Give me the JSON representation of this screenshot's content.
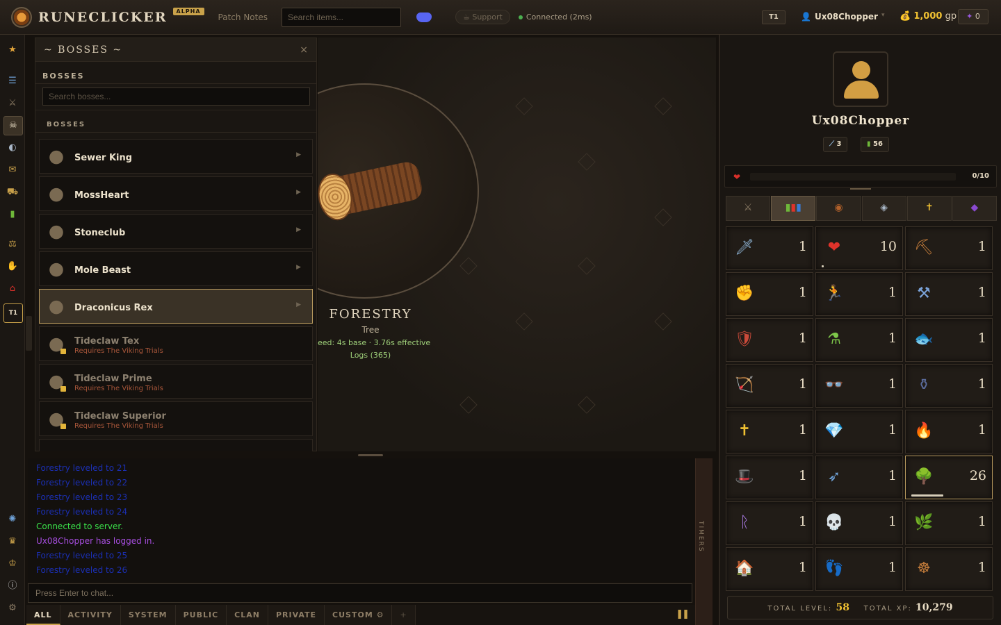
{
  "header": {
    "app_name": "RUNECLICKER",
    "badge": "ALPHA",
    "patch_notes": "Patch Notes",
    "search_placeholder": "Search items...",
    "support": "Support",
    "connection": "Connected (2ms)",
    "tier": "T1",
    "username": "Ux08Chopper",
    "gold": "1,000",
    "gold_unit": "gp",
    "gems": "0"
  },
  "left_nav": {
    "tier_badge": "T1",
    "icons": [
      "star-icon",
      "list-icon",
      "swords-icon",
      "skull-icon",
      "compass-icon",
      "scroll-icon",
      "cart-icon",
      "chart-icon",
      "scale-icon",
      "hand-icon",
      "house-icon",
      "tier-icon",
      "world-icon",
      "crown-icon",
      "trophy-icon",
      "info-icon",
      "settings-icon"
    ]
  },
  "boss_panel": {
    "title": "~ BOSSES ~",
    "close": "×",
    "subtitle": "BOSSES",
    "search_placeholder": "Search bosses...",
    "section_label": "BOSSES",
    "bosses": [
      {
        "name": "Sewer King",
        "locked": false,
        "requirement": ""
      },
      {
        "name": "MossHeart",
        "locked": false,
        "requirement": ""
      },
      {
        "name": "Stoneclub",
        "locked": false,
        "requirement": ""
      },
      {
        "name": "Mole Beast",
        "locked": false,
        "requirement": ""
      },
      {
        "name": "Draconicus Rex",
        "locked": false,
        "selected": true,
        "requirement": ""
      },
      {
        "name": "Tideclaw Tex",
        "locked": true,
        "requirement": "Requires The Viking Trials"
      },
      {
        "name": "Tideclaw Prime",
        "locked": true,
        "requirement": "Requires The Viking Trials"
      },
      {
        "name": "Tideclaw Superior",
        "locked": true,
        "requirement": "Requires The Viking Trials"
      }
    ]
  },
  "activity": {
    "skill": "FORESTRY",
    "target": "Tree",
    "speed": "eed: 4s base · 3.76s effective",
    "drop": "Logs (365)"
  },
  "chat": {
    "lines": [
      {
        "text": "Forestry leveled to 21",
        "kind": "blue"
      },
      {
        "text": "Forestry leveled to 22",
        "kind": "blue"
      },
      {
        "text": "Forestry leveled to 23",
        "kind": "blue"
      },
      {
        "text": "Forestry leveled to 24",
        "kind": "blue"
      },
      {
        "text": "Connected to server.",
        "kind": "green"
      },
      {
        "text": "Ux08Chopper has logged in.",
        "kind": "purple"
      },
      {
        "text": "Forestry leveled to 25",
        "kind": "blue"
      },
      {
        "text": "Forestry leveled to 26",
        "kind": "blue"
      }
    ],
    "input_placeholder": "Press Enter to chat...",
    "timers_label": "TIMERS",
    "tabs": [
      "ALL",
      "ACTIVITY",
      "SYSTEM",
      "PUBLIC",
      "CLAN",
      "PRIVATE",
      "CUSTOM ⚙",
      "+"
    ],
    "active_tab": "ALL",
    "pause_icon": "❚❚"
  },
  "profile": {
    "name": "Ux08Chopper",
    "combat_level": "3",
    "total_badge": "56",
    "hp_text": "0/10",
    "tabs": [
      "skills-tab",
      "stats-tab",
      "inventory-tab",
      "equipment-tab",
      "prayer-tab",
      "magic-tab"
    ],
    "skills": [
      {
        "icon": "sword-icon",
        "glyph": "🗡",
        "color": "#8fb5d6",
        "level": "1"
      },
      {
        "icon": "heart-icon",
        "glyph": "❤",
        "color": "#e0332b",
        "level": "10",
        "progress": 0.02
      },
      {
        "icon": "pickaxe-icon",
        "glyph": "⛏",
        "color": "#c07a3a",
        "level": "1"
      },
      {
        "icon": "fist-icon",
        "glyph": "✊",
        "color": "#d9905a",
        "level": "1"
      },
      {
        "icon": "thief-icon",
        "glyph": "🏃",
        "color": "#3a7bd5",
        "level": "1"
      },
      {
        "icon": "anvil-icon",
        "glyph": "⚒",
        "color": "#7aa2d8",
        "level": "1"
      },
      {
        "icon": "shield-icon",
        "glyph": "🛡",
        "color": "#c94a3a",
        "level": "1"
      },
      {
        "icon": "potion-icon",
        "glyph": "⚗",
        "color": "#7ec84a",
        "level": "1"
      },
      {
        "icon": "fish-icon",
        "glyph": "🐟",
        "color": "#6fbf6a",
        "level": "1"
      },
      {
        "icon": "bow-icon",
        "glyph": "🏹",
        "color": "#a8863a",
        "level": "1"
      },
      {
        "icon": "glasses-icon",
        "glyph": "👓",
        "color": "#3a4a5a",
        "level": "1"
      },
      {
        "icon": "cauldron-icon",
        "glyph": "⚱",
        "color": "#5a6a9a",
        "level": "1"
      },
      {
        "icon": "cross-icon",
        "glyph": "✝",
        "color": "#f1c232",
        "level": "1"
      },
      {
        "icon": "gem-icon",
        "glyph": "💎",
        "color": "#7ec8f0",
        "level": "1"
      },
      {
        "icon": "fire-icon",
        "glyph": "🔥",
        "color": "#e06a2a",
        "level": "1"
      },
      {
        "icon": "wizard-hat-icon",
        "glyph": "🎩",
        "color": "#8a4ad0",
        "level": "1"
      },
      {
        "icon": "arrows-icon",
        "glyph": "➶",
        "color": "#6fa2d8",
        "level": "1"
      },
      {
        "icon": "tree-icon",
        "glyph": "🌳",
        "color": "#6fb83a",
        "level": "26",
        "progress": 0.42,
        "highlight": true
      },
      {
        "icon": "rune-icon",
        "glyph": "ᚱ",
        "color": "#a87ae0",
        "level": "1"
      },
      {
        "icon": "skull-icon",
        "glyph": "💀",
        "color": "#e8e2d2",
        "level": "1"
      },
      {
        "icon": "herb-icon",
        "glyph": "🌿",
        "color": "#3ab86a",
        "level": "1"
      },
      {
        "icon": "house-icon",
        "glyph": "🏠",
        "color": "#d9302a",
        "level": "1"
      },
      {
        "icon": "footprints-icon",
        "glyph": "👣",
        "color": "#c0b8a8",
        "level": "1"
      },
      {
        "icon": "wheel-icon",
        "glyph": "☸",
        "color": "#c07a3a",
        "level": "1"
      }
    ],
    "total_level_label": "TOTAL LEVEL:",
    "total_level": "58",
    "total_xp_label": "TOTAL XP:",
    "total_xp": "10,279"
  }
}
